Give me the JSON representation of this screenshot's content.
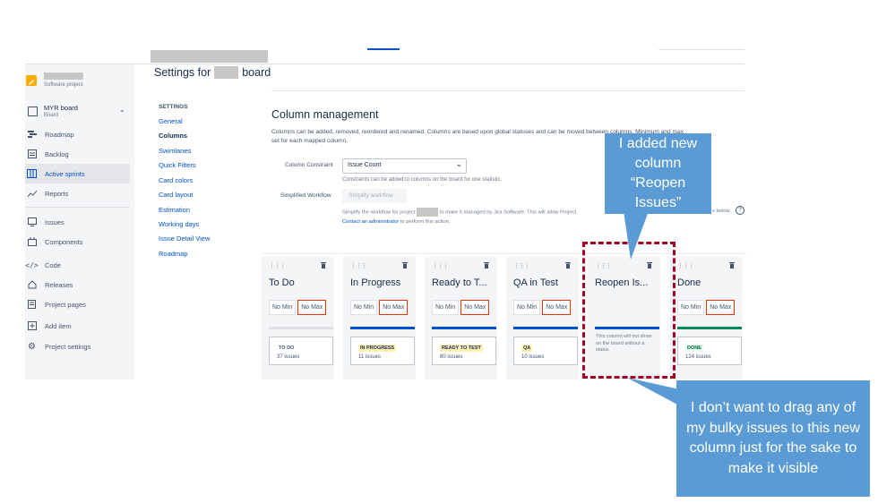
{
  "app": {
    "project_type": "Software project",
    "board_name": "MYR board",
    "board_sub": "Board"
  },
  "sidebar": {
    "items": [
      {
        "label": "Roadmap",
        "icon": "roadmap-icon"
      },
      {
        "label": "Backlog",
        "icon": "backlog-icon"
      },
      {
        "label": "Active sprints",
        "icon": "sprint-board-icon"
      },
      {
        "label": "Reports",
        "icon": "reports-icon"
      },
      {
        "label": "Issues",
        "icon": "issues-icon"
      },
      {
        "label": "Components",
        "icon": "components-icon"
      },
      {
        "label": "Code",
        "icon": "code-icon"
      },
      {
        "label": "Releases",
        "icon": "releases-icon"
      },
      {
        "label": "Project pages",
        "icon": "pages-icon"
      },
      {
        "label": "Add item",
        "icon": "add-item-icon"
      },
      {
        "label": "Project settings",
        "icon": "settings-gear-icon"
      }
    ]
  },
  "header": {
    "title_prefix": "Settings for",
    "title_suffix": "board"
  },
  "settings_nav": {
    "heading": "SETTINGS",
    "items": [
      "General",
      "Columns",
      "Swimlanes",
      "Quick Filters",
      "Card colors",
      "Card layout",
      "Estimation",
      "Working days",
      "Issue Detail View",
      "Roadmap"
    ]
  },
  "main": {
    "section_title": "Column management",
    "description_line1": "Columns can be added, removed, reordered and renamed. Columns are based upon global statuses and can be moved between columns. Minimum and max",
    "description_line2": "set for each mapped column.",
    "constraint_label": "Column Constraint",
    "constraint_value": "Issue Count",
    "constraint_help": "Constraints can be added to columns on the board for one statistic.",
    "workflow_label": "Simplified Workflow",
    "workflow_button": "Simplify workflow",
    "workflow_help_a": "Simplify the workflow for project",
    "workflow_help_b": "to make it managed by Jira Software. This will allow Project",
    "workflow_help_c": "s below.",
    "workflow_link": "Contact an administrator",
    "workflow_help_d": "to perform this action."
  },
  "columns": [
    {
      "title": "To Do",
      "min": "No Min",
      "max": "No Max",
      "status": "TO DO",
      "count": "37 issues",
      "bar_color": "#dfe1e6",
      "lozenge_bg": "#ffffff",
      "lozenge_fg": "#42526e"
    },
    {
      "title": "In Progress",
      "min": "No Min",
      "max": "No Max",
      "status": "IN PROGRESS",
      "count": "11 issues",
      "bar_color": "#0052cc",
      "lozenge_bg": "#fff0b3",
      "lozenge_fg": "#172b4d"
    },
    {
      "title": "Ready to T...",
      "min": "No Min",
      "max": "No Max",
      "status": "READY TO TEST",
      "count": "80 issues",
      "bar_color": "#0052cc",
      "lozenge_bg": "#fff0b3",
      "lozenge_fg": "#172b4d"
    },
    {
      "title": "QA in Test",
      "min": "No Min",
      "max": "No Max",
      "status": "QA",
      "count": "10 issues",
      "bar_color": "#0052cc",
      "lozenge_bg": "#fff0b3",
      "lozenge_fg": "#172b4d"
    },
    {
      "title": "Reopen Is...",
      "bar_color": "#0052cc",
      "empty_note": "This column will not show on the board without a status"
    },
    {
      "title": "Done",
      "min": "No Min",
      "max": "No Max",
      "status": "DONE",
      "count": "124 issues",
      "bar_color": "#00875a",
      "lozenge_bg": "#e3fcef",
      "lozenge_fg": "#006644"
    }
  ],
  "callouts": {
    "top": "I added new column “Reopen Issues”",
    "bottom": "I don’t want to drag any of my bulky issues to this new column just for the sake to make it visible"
  },
  "colors": {
    "accent": "#0052cc",
    "callout": "#5b9bd5",
    "highlight_border": "#a50021"
  }
}
